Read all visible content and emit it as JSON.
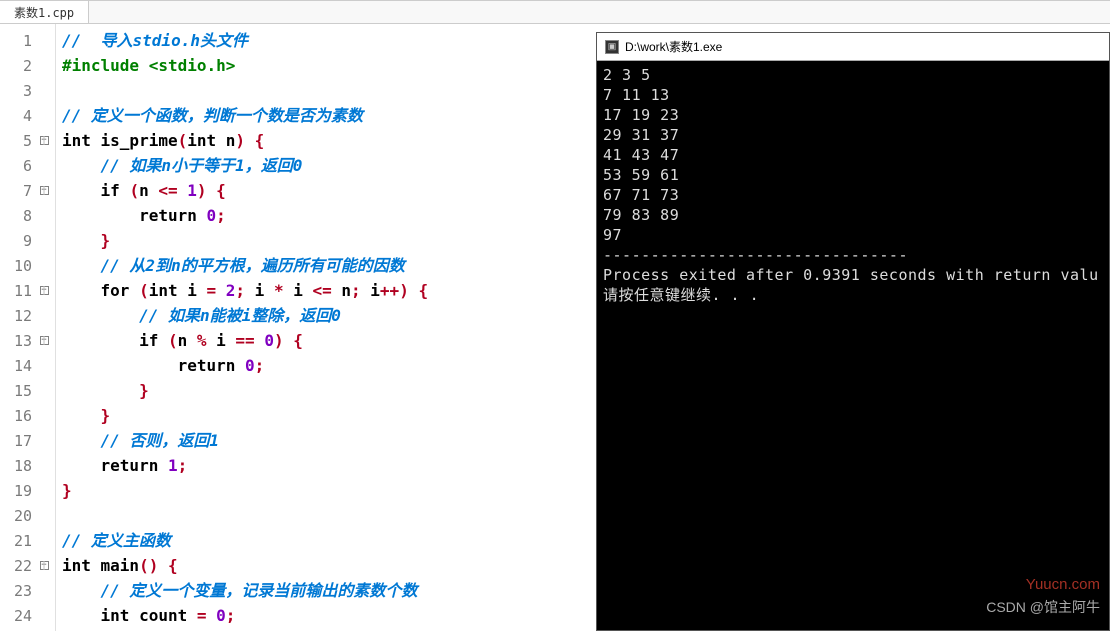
{
  "tab": {
    "name": "素数1.cpp"
  },
  "editor": {
    "lines": [
      {
        "n": 1,
        "fold": "",
        "tokens": [
          [
            "comment",
            "//  导入stdio.h头文件"
          ]
        ]
      },
      {
        "n": 2,
        "fold": "",
        "tokens": [
          [
            "pre",
            "#include <stdio.h>"
          ]
        ]
      },
      {
        "n": 3,
        "fold": "",
        "tokens": []
      },
      {
        "n": 4,
        "fold": "",
        "tokens": [
          [
            "comment",
            "// 定义一个函数，判断一个数是否为素数"
          ]
        ]
      },
      {
        "n": 5,
        "fold": "box",
        "tokens": [
          [
            "kw",
            "int "
          ],
          [
            "ident",
            "is_prime"
          ],
          [
            "punct",
            "("
          ],
          [
            "kw",
            "int "
          ],
          [
            "ident",
            "n"
          ],
          [
            "punct",
            ") {"
          ]
        ]
      },
      {
        "n": 6,
        "fold": "line",
        "tokens": [
          [
            "ident",
            "    "
          ],
          [
            "comment",
            "// 如果n小于等于1，返回0"
          ]
        ]
      },
      {
        "n": 7,
        "fold": "box",
        "tokens": [
          [
            "ident",
            "    "
          ],
          [
            "kw",
            "if "
          ],
          [
            "punct",
            "("
          ],
          [
            "ident",
            "n "
          ],
          [
            "punct",
            "<= "
          ],
          [
            "num",
            "1"
          ],
          [
            "punct",
            ") {"
          ]
        ]
      },
      {
        "n": 8,
        "fold": "line",
        "tokens": [
          [
            "ident",
            "        "
          ],
          [
            "kw",
            "return "
          ],
          [
            "num",
            "0"
          ],
          [
            "punct",
            ";"
          ]
        ]
      },
      {
        "n": 9,
        "fold": "line",
        "tokens": [
          [
            "ident",
            "    "
          ],
          [
            "punct",
            "}"
          ]
        ]
      },
      {
        "n": 10,
        "fold": "line",
        "tokens": [
          [
            "ident",
            "    "
          ],
          [
            "comment",
            "// 从2到n的平方根，遍历所有可能的因数"
          ]
        ]
      },
      {
        "n": 11,
        "fold": "box",
        "tokens": [
          [
            "ident",
            "    "
          ],
          [
            "kw",
            "for "
          ],
          [
            "punct",
            "("
          ],
          [
            "kw",
            "int "
          ],
          [
            "ident",
            "i "
          ],
          [
            "punct",
            "= "
          ],
          [
            "num",
            "2"
          ],
          [
            "punct",
            "; "
          ],
          [
            "ident",
            "i "
          ],
          [
            "punct",
            "* "
          ],
          [
            "ident",
            "i "
          ],
          [
            "punct",
            "<= "
          ],
          [
            "ident",
            "n"
          ],
          [
            "punct",
            "; "
          ],
          [
            "ident",
            "i"
          ],
          [
            "punct",
            "++) {"
          ]
        ]
      },
      {
        "n": 12,
        "fold": "line",
        "tokens": [
          [
            "ident",
            "        "
          ],
          [
            "comment",
            "// 如果n能被i整除，返回0"
          ]
        ]
      },
      {
        "n": 13,
        "fold": "box",
        "tokens": [
          [
            "ident",
            "        "
          ],
          [
            "kw",
            "if "
          ],
          [
            "punct",
            "("
          ],
          [
            "ident",
            "n "
          ],
          [
            "punct",
            "% "
          ],
          [
            "ident",
            "i "
          ],
          [
            "punct",
            "== "
          ],
          [
            "num",
            "0"
          ],
          [
            "punct",
            ") {"
          ]
        ]
      },
      {
        "n": 14,
        "fold": "line",
        "tokens": [
          [
            "ident",
            "            "
          ],
          [
            "kw",
            "return "
          ],
          [
            "num",
            "0"
          ],
          [
            "punct",
            ";"
          ]
        ]
      },
      {
        "n": 15,
        "fold": "line",
        "tokens": [
          [
            "ident",
            "        "
          ],
          [
            "punct",
            "}"
          ]
        ]
      },
      {
        "n": 16,
        "fold": "line",
        "tokens": [
          [
            "ident",
            "    "
          ],
          [
            "punct",
            "}"
          ]
        ]
      },
      {
        "n": 17,
        "fold": "line",
        "tokens": [
          [
            "ident",
            "    "
          ],
          [
            "comment",
            "// 否则，返回1"
          ]
        ]
      },
      {
        "n": 18,
        "fold": "line",
        "tokens": [
          [
            "ident",
            "    "
          ],
          [
            "kw",
            "return "
          ],
          [
            "num",
            "1"
          ],
          [
            "punct",
            ";"
          ]
        ]
      },
      {
        "n": 19,
        "fold": "line",
        "tokens": [
          [
            "punct",
            "}"
          ]
        ]
      },
      {
        "n": 20,
        "fold": "",
        "tokens": []
      },
      {
        "n": 21,
        "fold": "",
        "tokens": [
          [
            "comment",
            "// 定义主函数"
          ]
        ]
      },
      {
        "n": 22,
        "fold": "box",
        "tokens": [
          [
            "kw",
            "int "
          ],
          [
            "ident",
            "main"
          ],
          [
            "punct",
            "() {"
          ]
        ]
      },
      {
        "n": 23,
        "fold": "line",
        "tokens": [
          [
            "ident",
            "    "
          ],
          [
            "comment",
            "// 定义一个变量，记录当前输出的素数个数"
          ]
        ]
      },
      {
        "n": 24,
        "fold": "line",
        "tokens": [
          [
            "ident",
            "    "
          ],
          [
            "kw",
            "int "
          ],
          [
            "ident",
            "count "
          ],
          [
            "punct",
            "= "
          ],
          [
            "num",
            "0"
          ],
          [
            "punct",
            ";"
          ]
        ]
      }
    ]
  },
  "console": {
    "title": "D:\\work\\素数1.exe",
    "output": "2 3 5\n7 11 13\n17 19 23\n29 31 37\n41 43 47\n53 59 61\n67 71 73\n79 83 89\n97\n--------------------------------\nProcess exited after 0.9391 seconds with return valu\n请按任意键继续. . ."
  },
  "watermarks": {
    "right": "Yuucn.com",
    "bottom": "CSDN @馆主阿牛"
  }
}
